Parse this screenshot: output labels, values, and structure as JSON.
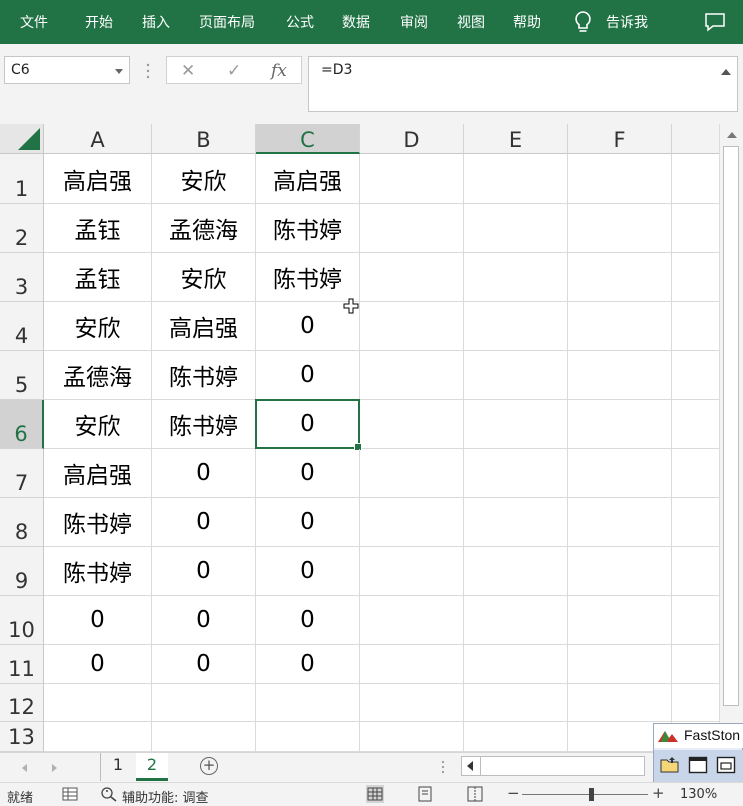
{
  "ribbon": {
    "tabs": [
      "文件",
      "开始",
      "插入",
      "页面布局",
      "公式",
      "数据",
      "审阅",
      "视图",
      "帮助"
    ],
    "tell_me": "告诉我"
  },
  "formula_bar": {
    "name_box": "C6",
    "formula": "=D3",
    "cancel": "✕",
    "enter": "✓",
    "fx": "fx"
  },
  "columns": [
    "A",
    "B",
    "C",
    "D",
    "E",
    "F"
  ],
  "rows": [
    "1",
    "2",
    "3",
    "4",
    "5",
    "6",
    "7",
    "8",
    "9",
    "10",
    "11",
    "12",
    "13"
  ],
  "cells": [
    [
      "高启强",
      "安欣",
      "高启强"
    ],
    [
      "孟钰",
      "孟德海",
      "陈书婷"
    ],
    [
      "孟钰",
      "安欣",
      "陈书婷"
    ],
    [
      "安欣",
      "高启强",
      "0"
    ],
    [
      "孟德海",
      "陈书婷",
      "0"
    ],
    [
      "安欣",
      "陈书婷",
      "0"
    ],
    [
      "高启强",
      "0",
      "0"
    ],
    [
      "陈书婷",
      "0",
      "0"
    ],
    [
      "陈书婷",
      "0",
      "0"
    ],
    [
      "0",
      "0",
      "0"
    ],
    [
      "0",
      "0",
      "0"
    ],
    [
      "",
      "",
      ""
    ],
    [
      "",
      "",
      ""
    ]
  ],
  "selected_cell": "C6",
  "sheets": [
    "1",
    "2"
  ],
  "active_sheet": "2",
  "add_sheet": "+",
  "floating_window": {
    "title": "FastSton"
  },
  "status": {
    "ready": "就绪",
    "accessibility": "辅助功能: 调查",
    "zoom_minus": "−",
    "zoom_plus": "+",
    "zoom": "130%"
  },
  "colors": {
    "accent": "#217346",
    "grid": "#dadada"
  }
}
